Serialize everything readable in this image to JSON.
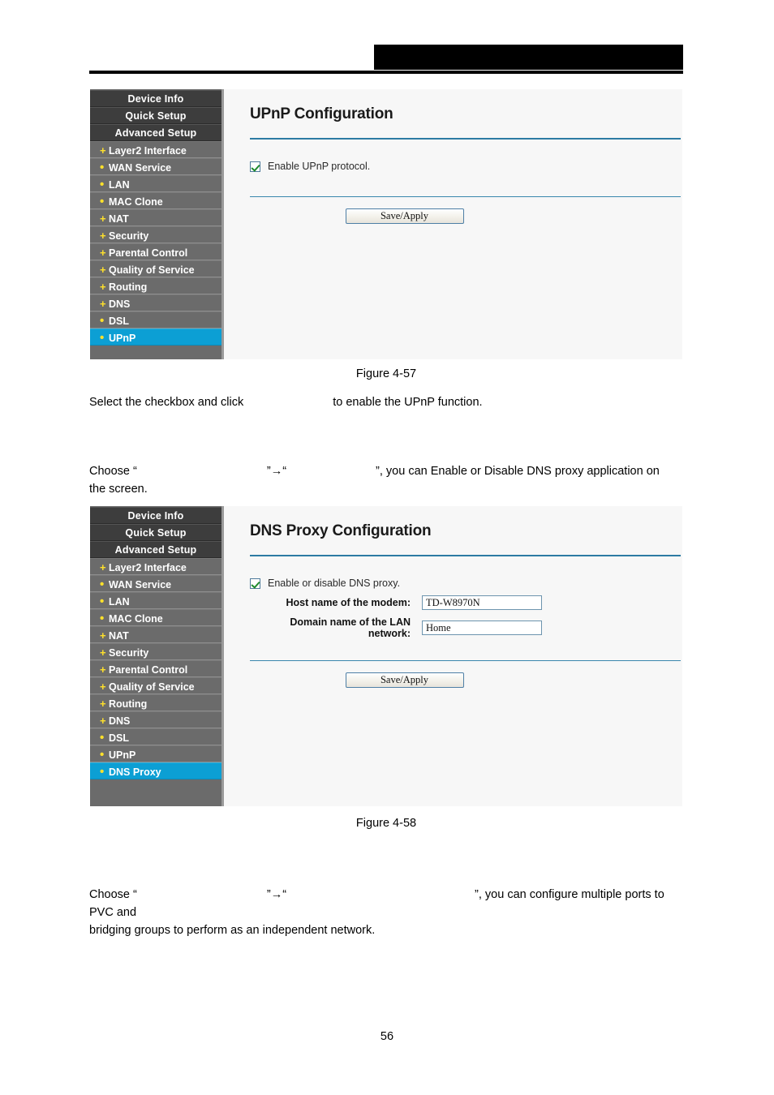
{
  "document": {
    "page_number": "56",
    "header_redaction": ""
  },
  "figures": {
    "upnp_caption": "Figure 4-57",
    "dnsproxy_caption": "Figure 4-58"
  },
  "sidebar_upnp": {
    "items": [
      {
        "label": "Device Info",
        "level": "top",
        "marker": "",
        "active": false
      },
      {
        "label": "Quick Setup",
        "level": "top",
        "marker": "",
        "active": false
      },
      {
        "label": "Advanced Setup",
        "level": "top",
        "marker": "",
        "active": false
      },
      {
        "label": "Layer2 Interface",
        "level": "sub",
        "marker": "+",
        "active": false
      },
      {
        "label": "WAN Service",
        "level": "sub",
        "marker": "•",
        "active": false
      },
      {
        "label": "LAN",
        "level": "sub",
        "marker": "•",
        "active": false
      },
      {
        "label": "MAC Clone",
        "level": "sub",
        "marker": "•",
        "active": false
      },
      {
        "label": "NAT",
        "level": "sub",
        "marker": "+",
        "active": false
      },
      {
        "label": "Security",
        "level": "sub",
        "marker": "+",
        "active": false
      },
      {
        "label": "Parental Control",
        "level": "sub",
        "marker": "+",
        "active": false
      },
      {
        "label": "Quality of Service",
        "level": "sub",
        "marker": "+",
        "active": false
      },
      {
        "label": "Routing",
        "level": "sub",
        "marker": "+",
        "active": false
      },
      {
        "label": "DNS",
        "level": "sub",
        "marker": "+",
        "active": false
      },
      {
        "label": "DSL",
        "level": "sub",
        "marker": "•",
        "active": false
      },
      {
        "label": "UPnP",
        "level": "sub",
        "marker": "•",
        "active": true
      }
    ]
  },
  "sidebar_dnsproxy": {
    "items": [
      {
        "label": "Device Info",
        "level": "top",
        "marker": "",
        "active": false
      },
      {
        "label": "Quick Setup",
        "level": "top",
        "marker": "",
        "active": false
      },
      {
        "label": "Advanced Setup",
        "level": "top",
        "marker": "",
        "active": false
      },
      {
        "label": "Layer2 Interface",
        "level": "sub",
        "marker": "+",
        "active": false
      },
      {
        "label": "WAN Service",
        "level": "sub",
        "marker": "•",
        "active": false
      },
      {
        "label": "LAN",
        "level": "sub",
        "marker": "•",
        "active": false
      },
      {
        "label": "MAC Clone",
        "level": "sub",
        "marker": "•",
        "active": false
      },
      {
        "label": "NAT",
        "level": "sub",
        "marker": "+",
        "active": false
      },
      {
        "label": "Security",
        "level": "sub",
        "marker": "+",
        "active": false
      },
      {
        "label": "Parental Control",
        "level": "sub",
        "marker": "+",
        "active": false
      },
      {
        "label": "Quality of Service",
        "level": "sub",
        "marker": "+",
        "active": false
      },
      {
        "label": "Routing",
        "level": "sub",
        "marker": "+",
        "active": false
      },
      {
        "label": "DNS",
        "level": "sub",
        "marker": "+",
        "active": false
      },
      {
        "label": "DSL",
        "level": "sub",
        "marker": "•",
        "active": false
      },
      {
        "label": "UPnP",
        "level": "sub",
        "marker": "•",
        "active": false
      },
      {
        "label": "DNS Proxy",
        "level": "sub",
        "marker": "•",
        "active": true
      }
    ]
  },
  "upnp_panel": {
    "title": "UPnP Configuration",
    "enable_checkbox_label": "Enable UPnP protocol.",
    "enable_checkbox_checked": true,
    "save_label": "Save/Apply"
  },
  "dnsproxy_panel": {
    "title": "DNS Proxy Configuration",
    "enable_checkbox_label": "Enable or disable DNS proxy.",
    "enable_checkbox_checked": true,
    "host_label": "Host name of the modem:",
    "host_value": "TD-W8970N",
    "domain_label": "Domain name of the LAN network:",
    "domain_value": "Home",
    "save_label": "Save/Apply"
  },
  "body_text": {
    "upnp_instruction_before": "Select the checkbox and click",
    "upnp_instruction_after": "to enable the UPnP function.",
    "dnsproxy_choose_prefix": "Choose “",
    "dnsproxy_choose_quote1": "”",
    "dnsproxy_choose_arrow": "→",
    "dnsproxy_choose_quote2": "“",
    "dnsproxy_choose_suffix": "”, you can Enable or Disable DNS proxy application on",
    "dnsproxy_choose_line2": "the screen.",
    "interface_choose_prefix": "Choose “",
    "interface_choose_quote1": "”",
    "interface_choose_arrow": "→",
    "interface_choose_quote2": "“",
    "interface_choose_suffix": "”, you can configure multiple ports to PVC and",
    "interface_choose_line2": "bridging groups to perform as an independent network."
  },
  "colors": {
    "sidebar_top_bg": "#3d3d3d",
    "sidebar_sub_bg": "#6b6b6b",
    "sidebar_active_bg": "#0c9fd4",
    "marker_yellow": "#ffe12b",
    "separator_blue": "#2d7ba3",
    "panel_bg": "#f7f7f7"
  }
}
